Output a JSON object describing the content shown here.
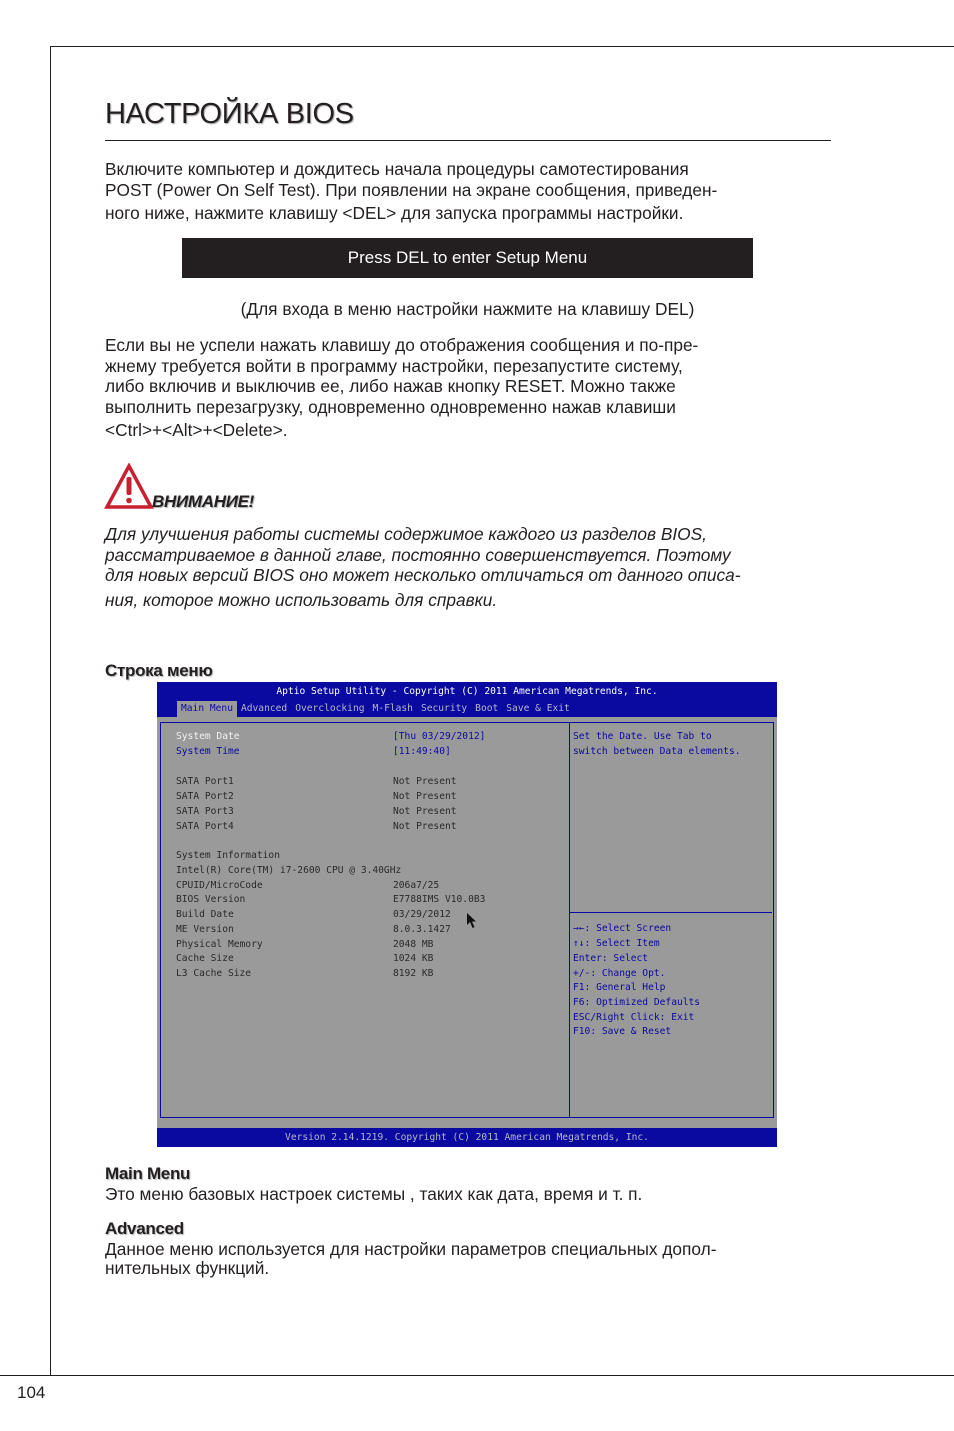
{
  "page": {
    "title": "НАСТРОЙКА BIOS",
    "page_number": "104"
  },
  "intro": {
    "lines": [
      "Включите компьютер и дождитесь начала процедуры самотестирования",
      "POST (Power On Self Test). При появлении на экране сообщения, приведен-",
      "ного ниже, нажмите клавишу <DEL> для запуска программы настройки."
    ]
  },
  "post_message": {
    "text": "Press DEL to enter Setup Menu",
    "caption": "(Для входа в меню настройки нажмите на клавишу DEL)"
  },
  "restart_paragraph": {
    "lines": [
      "Если вы не успели нажать клавишу до отображения сообщения и по-пре-",
      "жнему требуется войти в программу настройки, перезапустите систему,",
      "либо включив и выключив ее, либо нажав кнопку RESET. Можно также",
      "выполнить перезагрузку, одновременно одновременно нажав клавиши",
      "<Ctrl>+<Alt>+<Delete>."
    ]
  },
  "warning": {
    "icon": "warning-triangle-icon",
    "icon_color": "#c8202e",
    "label": "ВНИМАНИЕ!",
    "lines": [
      "Для улучшения работы системы содержимое каждого из разделов BIOS,",
      "рассматриваемое в данной главе, постоянно совершенствуется. Поэтому",
      "для новых версий BIOS оно может несколько отличаться от данного описа-",
      "ния, которое можно использовать для справки."
    ]
  },
  "menu_bar_heading": "Строка меню",
  "bios": {
    "colors": {
      "header": "#0a0aa0",
      "background": "#9a9a9a"
    },
    "title": "Aptio Setup Utility - Copyright (C) 2011 American Megatrends, Inc.",
    "tabs": [
      {
        "label": "Main Menu",
        "active": true
      },
      {
        "label": "Advanced",
        "active": false
      },
      {
        "label": "Overclocking",
        "active": false
      },
      {
        "label": "M-Flash",
        "active": false
      },
      {
        "label": "Security",
        "active": false
      },
      {
        "label": "Boot",
        "active": false
      },
      {
        "label": "Save & Exit",
        "active": false
      }
    ],
    "settings": [
      {
        "label": "System Date",
        "value": "[Thu 03/29/2012]"
      },
      {
        "label": "System Time",
        "value": "[11:49:40]"
      }
    ],
    "sata_ports": [
      {
        "label": "SATA Port1",
        "value": "Not Present"
      },
      {
        "label": "SATA Port2",
        "value": "Not Present"
      },
      {
        "label": "SATA Port3",
        "value": "Not Present"
      },
      {
        "label": "SATA Port4",
        "value": "Not Present"
      }
    ],
    "system_info_heading": "System Information",
    "cpu_name": "Intel(R) Core(TM) i7-2600 CPU @ 3.40GHz",
    "system_info": [
      {
        "label": "CPUID/MicroCode",
        "value": "206a7/25"
      },
      {
        "label": "BIOS Version",
        "value": "E7788IMS V10.0B3"
      },
      {
        "label": "Build Date",
        "value": "03/29/2012"
      },
      {
        "label": "ME Version",
        "value": "8.0.3.1427"
      },
      {
        "label": "Physical Memory",
        "value": "2048 MB"
      },
      {
        "label": "Cache Size",
        "value": "1024 KB"
      },
      {
        "label": "L3 Cache Size",
        "value": "8192 KB"
      }
    ],
    "help_text": [
      "Set the Date. Use Tab to",
      "switch between Data elements."
    ],
    "key_help": [
      "→←: Select Screen",
      "↑↓: Select Item",
      "Enter: Select",
      "+/-: Change Opt.",
      "F1: General Help",
      "F6: Optimized Defaults",
      "ESC/Right Click: Exit",
      "F10: Save & Reset"
    ],
    "footer": "Version 2.14.1219. Copyright (C) 2011 American Megatrends, Inc."
  },
  "sections": [
    {
      "heading": "Main Menu",
      "text": "Это меню базовых настроек системы , таких как дата, время и т. п."
    },
    {
      "heading": "Advanced",
      "lines": [
        "Данное меню используется для настройки параметров специальных допол-",
        "нительных функций."
      ]
    }
  ]
}
